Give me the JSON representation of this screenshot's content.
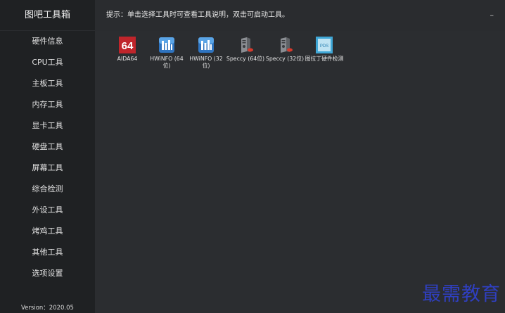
{
  "app": {
    "title": "图吧工具箱",
    "version": "Version：2020.05"
  },
  "sidebar": {
    "items": [
      {
        "label": "硬件信息"
      },
      {
        "label": "CPU工具"
      },
      {
        "label": "主板工具"
      },
      {
        "label": "内存工具"
      },
      {
        "label": "显卡工具"
      },
      {
        "label": "硬盘工具"
      },
      {
        "label": "屏幕工具"
      },
      {
        "label": "综合检测"
      },
      {
        "label": "外设工具"
      },
      {
        "label": "烤鸡工具"
      },
      {
        "label": "其他工具"
      },
      {
        "label": "选项设置"
      }
    ]
  },
  "topbar": {
    "hint": "提示：单击选择工具时可查看工具说明，双击可启动工具。",
    "minimize": "–"
  },
  "tools": [
    {
      "label": "AIDA64",
      "icon": "aida64-icon",
      "icon_text": "64"
    },
    {
      "label": "HWiNFO (64位)",
      "icon": "hwinfo-icon"
    },
    {
      "label": "HWiNFO (32位)",
      "icon": "hwinfo-icon"
    },
    {
      "label": "Speccy (64位)",
      "icon": "speccy-icon"
    },
    {
      "label": "Speccy (32位)",
      "icon": "speccy-icon"
    },
    {
      "label": "图拉丁硬件检测",
      "icon": "tulading-icon",
      "icon_text": "PDS"
    }
  ],
  "watermark": {
    "text": "最需教育"
  },
  "colors": {
    "sidebar_bg": "#1f2123",
    "main_bg": "#2b2d30",
    "aida_red": "#c0252b",
    "watermark_blue": "#2f3fc0"
  }
}
